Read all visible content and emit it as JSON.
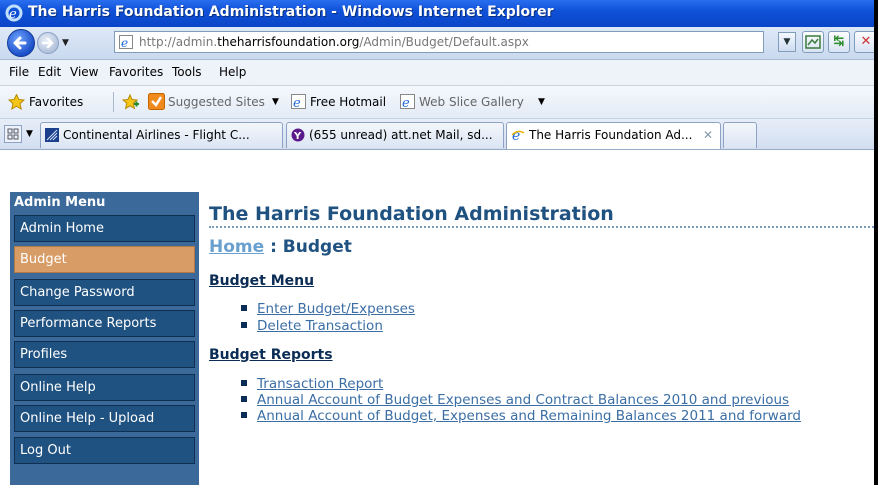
{
  "window": {
    "title": "The Harris Foundation Administration - Windows Internet Explorer"
  },
  "address_bar": {
    "url_prefix": "http://admin.",
    "url_domain": "theharrisfoundation.org",
    "url_path": "/Admin/Budget/Default.aspx"
  },
  "menu_bar": {
    "items": [
      "File",
      "Edit",
      "View",
      "Favorites",
      "Tools",
      "Help"
    ]
  },
  "favorites_bar": {
    "favorites_label": "Favorites",
    "suggested_sites": "Suggested Sites",
    "free_hotmail": "Free Hotmail",
    "web_slice_gallery": "Web Slice Gallery"
  },
  "tabs": [
    {
      "label": "Continental Airlines - Flight C...",
      "icon": "continental-icon",
      "active": false
    },
    {
      "label": "(655 unread) att.net Mail, sd...",
      "icon": "yahoo-icon",
      "active": false
    },
    {
      "label": "The Harris Foundation Ad...",
      "icon": "ie-icon",
      "active": true
    }
  ],
  "sidebar": {
    "title": "Admin Menu",
    "items": [
      {
        "label": "Admin Home",
        "active": false
      },
      {
        "label": "Budget",
        "active": true
      },
      {
        "label": "Change Password",
        "active": false
      },
      {
        "label": "Performance Reports",
        "active": false
      },
      {
        "label": "Profiles",
        "active": false
      },
      {
        "label": "Online Help",
        "active": false
      },
      {
        "label": "Online Help - Upload",
        "active": false
      },
      {
        "label": "Log Out",
        "active": false
      }
    ]
  },
  "main": {
    "title": "The Harris Foundation Administration",
    "breadcrumb_home": "Home",
    "breadcrumb_current": " : Budget",
    "budget_menu": {
      "heading": "Budget Menu",
      "items": [
        "Enter Budget/Expenses",
        "Delete Transaction"
      ]
    },
    "budget_reports": {
      "heading": "Budget Reports",
      "items": [
        "Transaction Report",
        "Annual Account of Budget Expenses and Contract Balances 2010 and previous",
        "Annual Account of Budget, Expenses and Remaining Balances 2011 and forward"
      ]
    }
  },
  "colors": {
    "titlebar": "#0f51d8",
    "sidebar_item": "#1f5281",
    "sidebar_active": "#d89c67",
    "heading": "#1f5281",
    "link": "#3b6ea5"
  }
}
